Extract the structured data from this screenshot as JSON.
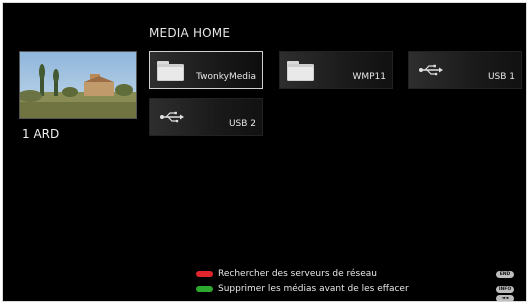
{
  "header": {
    "title": "MEDIA HOME"
  },
  "preview": {
    "channel": "1 ARD"
  },
  "servers": [
    {
      "label": "TwonkyMedia",
      "icon": "folder-icon",
      "selected": true
    },
    {
      "label": "WMP11",
      "icon": "folder-icon",
      "selected": false
    },
    {
      "label": "USB 1",
      "icon": "usb-icon",
      "selected": false
    },
    {
      "label": "USB 2",
      "icon": "usb-icon",
      "selected": false
    }
  ],
  "legend": [
    {
      "label": "Rechercher des serveurs de réseau",
      "color": "#e0262c"
    },
    {
      "label": "Supprimer les médias avant de les effacer",
      "color": "#2fa82f"
    }
  ],
  "keys": {
    "end": "END",
    "info": "INFO",
    "back": "◄◄"
  }
}
